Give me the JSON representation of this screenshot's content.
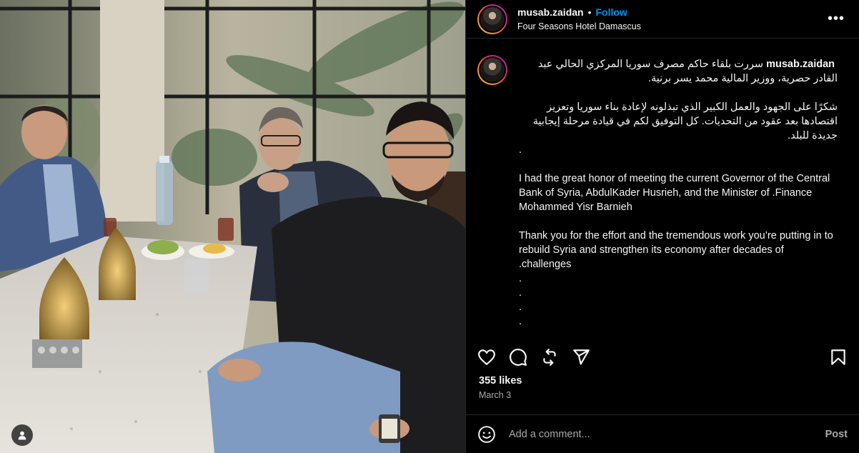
{
  "post": {
    "username": "musab.zaidan",
    "separator": "•",
    "follow_label": "Follow",
    "location": "Four Seasons Hotel Damascus",
    "more_label": "•••"
  },
  "caption": {
    "username": "musab.zaidan",
    "ar_line1": "سررت بلقاء حاكم مصرف سوريا المركزي الحالي عبد القادر حصرية، ووزير المالية محمد يسر برنية.",
    "ar_para2": "شكرًا على الجهود والعمل الكبير الذي تبذلونه لإعادة بناء سوريا وتعزيز اقتصادها بعد عقود من التحديات. كل التوفيق لكم في قيادة مرحلة إيجابية جديدة للبلد.",
    "dot1": ".",
    "en_para1": "I had the great honor of meeting the current Governor of the Central Bank of Syria, AbdulKader Husrieh, and the Minister of .Finance Mohammed Yisr Barnieh",
    "en_para2": "Thank you for the effort and the tremendous work you’re putting in to rebuild Syria and strengthen its economy after decades of .challenges",
    "dots": [
      ".",
      ".",
      ".",
      "."
    ]
  },
  "engagement": {
    "likes": "355 likes",
    "date": "March 3"
  },
  "comment_box": {
    "placeholder": "Add a comment...",
    "post_label": "Post"
  },
  "icons": {
    "like": "heart-icon",
    "comment": "comment-icon",
    "share": "repost-icon",
    "send": "send-icon",
    "save": "bookmark-icon",
    "emoji": "emoji-icon",
    "tag": "user-tag-icon"
  }
}
